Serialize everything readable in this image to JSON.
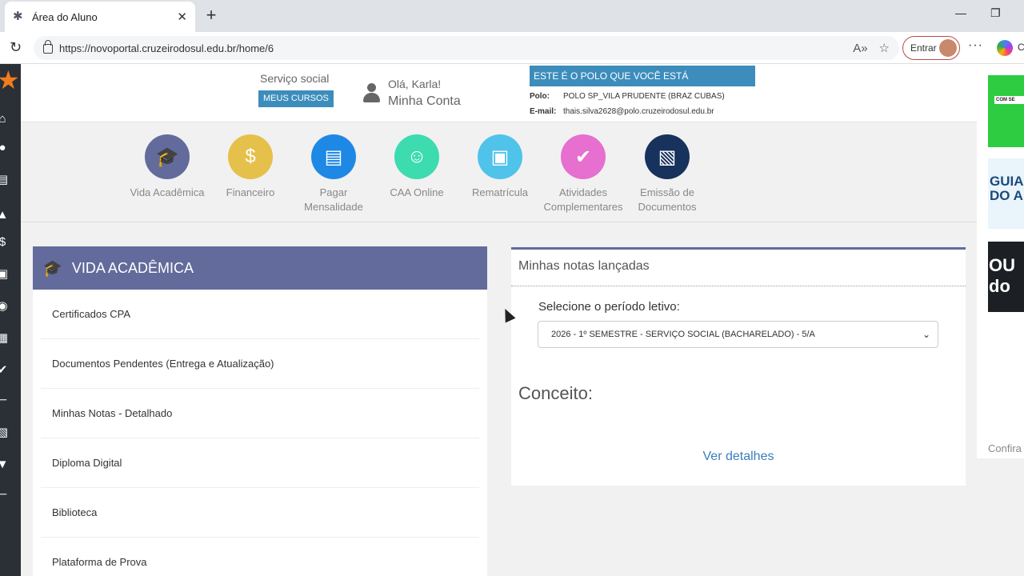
{
  "browser": {
    "tab_title": "Área do Aluno",
    "url": "https://novoportal.cruzeirodosul.edu.br/home/6",
    "signin_label": "Entrar",
    "copilot_label": "C"
  },
  "header": {
    "course": "Serviço social",
    "my_courses": "MEUS CURSOS",
    "greeting": "Olá, Karla!",
    "account": "Minha Conta",
    "polo_banner": "ESTE É O POLO QUE VOCÊ ESTÁ MATRICULADO",
    "polo_label": "Polo:",
    "polo_value": "POLO SP_VILA PRUDENTE (BRAZ CUBAS)",
    "email_label": "E-mail:",
    "email_value": "thais.silva2628@polo.cruzeirodosul.edu.br"
  },
  "nav": [
    {
      "label": "Vida Acadêmica",
      "color": "#626b9b",
      "icon": "graduation-cap-icon"
    },
    {
      "label": "Financeiro",
      "color": "#e5c04a",
      "icon": "dollar-coin-icon"
    },
    {
      "label": "Pagar\nMensalidade",
      "color": "#1e88e5",
      "icon": "invoice-icon"
    },
    {
      "label": "CAA Online",
      "color": "#3ddbb0",
      "icon": "support-agent-icon"
    },
    {
      "label": "Rematrícula",
      "color": "#4fc3ea",
      "icon": "id-card-icon"
    },
    {
      "label": "Atividades\nComplementares",
      "color": "#e66fcf",
      "icon": "check-badge-icon"
    },
    {
      "label": "Emissão de\nDocumentos",
      "color": "#17325c",
      "icon": "document-download-icon"
    }
  ],
  "vida_academica": {
    "title": "VIDA ACADÊMICA",
    "items": [
      "Certificados CPA",
      "Documentos Pendentes (Entrega e Atualização)",
      "Minhas Notas - Detalhado",
      "Diploma Digital",
      "Biblioteca",
      "Plataforma de Prova"
    ]
  },
  "notas": {
    "title": "Minhas notas lançadas",
    "periodo_label": "Selecione o período letivo:",
    "periodo_selected": "2026 - 1º SEMESTRE - SERVIÇO SOCIAL (BACHARELADO) - 5/A",
    "conceito_label": "Conceito:",
    "ver_detalhes": "Ver detalhes"
  },
  "ads": {
    "ad1_text": "COM SE",
    "ad2_text": "GUIA\nDO A",
    "ad3_text": "OU\ndo",
    "confira": "Confira"
  }
}
